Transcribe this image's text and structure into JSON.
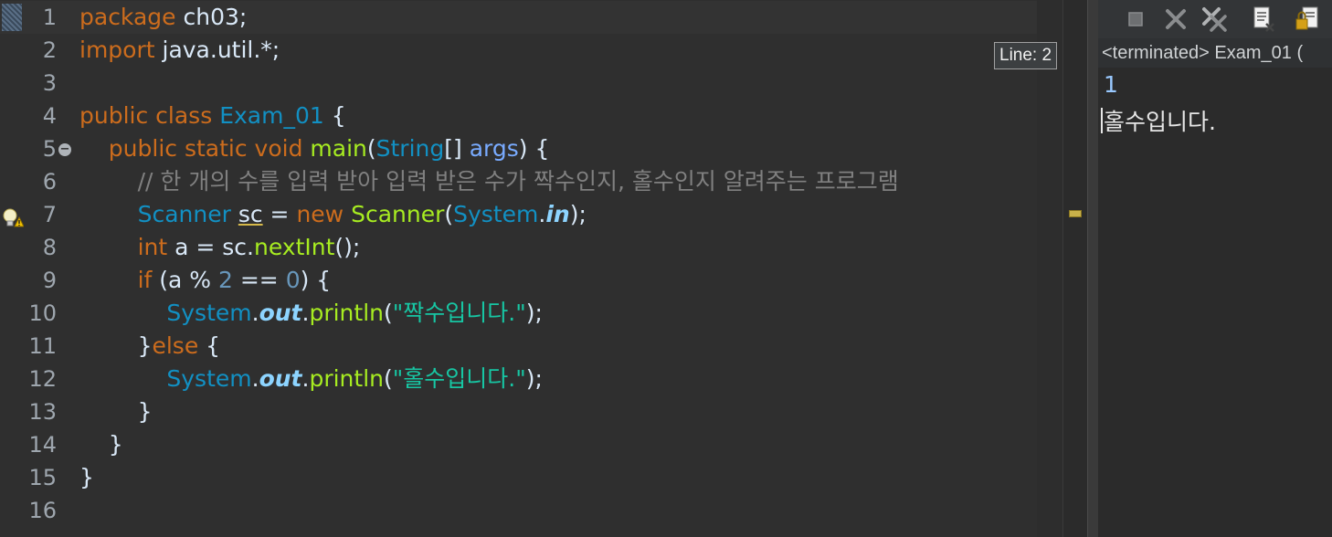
{
  "editor": {
    "lines": [
      {
        "n": "1",
        "tokens": [
          [
            "kw",
            "package"
          ],
          [
            "plain",
            " ch03;"
          ]
        ]
      },
      {
        "n": "2",
        "tokens": [
          [
            "kw",
            "import"
          ],
          [
            "plain",
            " java.util.*;"
          ]
        ]
      },
      {
        "n": "3",
        "tokens": []
      },
      {
        "n": "4",
        "tokens": [
          [
            "kw",
            "public class "
          ],
          [
            "type",
            "Exam_01"
          ],
          [
            "plain",
            " {"
          ]
        ]
      },
      {
        "n": "5",
        "tokens": [
          [
            "plain",
            "    "
          ],
          [
            "kw",
            "public static void "
          ],
          [
            "method",
            "main"
          ],
          [
            "plain",
            "("
          ],
          [
            "type",
            "String"
          ],
          [
            "plain",
            "[] "
          ],
          [
            "param",
            "args"
          ],
          [
            "plain",
            ") {"
          ]
        ]
      },
      {
        "n": "6",
        "tokens": [
          [
            "plain",
            "        "
          ],
          [
            "comment",
            "// 한 개의 수를 입력 받아 입력 받은 수가 짝수인지, 홀수인지 알려주는 프로그램"
          ]
        ]
      },
      {
        "n": "7",
        "tokens": [
          [
            "plain",
            "        "
          ],
          [
            "type",
            "Scanner"
          ],
          [
            "plain",
            " "
          ],
          [
            "warnvar",
            "sc"
          ],
          [
            "plain",
            " = "
          ],
          [
            "kw",
            "new "
          ],
          [
            "method",
            "Scanner"
          ],
          [
            "plain",
            "("
          ],
          [
            "type",
            "System"
          ],
          [
            "plain",
            "."
          ],
          [
            "static",
            "in"
          ],
          [
            "plain",
            ");"
          ]
        ]
      },
      {
        "n": "8",
        "tokens": [
          [
            "plain",
            "        "
          ],
          [
            "kw",
            "int"
          ],
          [
            "plain",
            " a = sc."
          ],
          [
            "method",
            "nextInt"
          ],
          [
            "plain",
            "();"
          ]
        ]
      },
      {
        "n": "9",
        "tokens": [
          [
            "plain",
            "        "
          ],
          [
            "kw",
            "if"
          ],
          [
            "plain",
            " (a % "
          ],
          [
            "num",
            "2"
          ],
          [
            "plain",
            " == "
          ],
          [
            "num",
            "0"
          ],
          [
            "plain",
            ") {"
          ]
        ]
      },
      {
        "n": "10",
        "tokens": [
          [
            "plain",
            "            "
          ],
          [
            "type",
            "System"
          ],
          [
            "plain",
            "."
          ],
          [
            "static",
            "out"
          ],
          [
            "plain",
            "."
          ],
          [
            "method",
            "println"
          ],
          [
            "plain",
            "("
          ],
          [
            "str",
            "\"짝수입니다.\""
          ],
          [
            "plain",
            ");"
          ]
        ]
      },
      {
        "n": "11",
        "tokens": [
          [
            "plain",
            "        }"
          ],
          [
            "kw",
            "else"
          ],
          [
            "plain",
            " {"
          ]
        ]
      },
      {
        "n": "12",
        "tokens": [
          [
            "plain",
            "            "
          ],
          [
            "type",
            "System"
          ],
          [
            "plain",
            "."
          ],
          [
            "static",
            "out"
          ],
          [
            "plain",
            "."
          ],
          [
            "method",
            "println"
          ],
          [
            "plain",
            "("
          ],
          [
            "str",
            "\"홀수입니다.\""
          ],
          [
            "plain",
            ");"
          ]
        ]
      },
      {
        "n": "13",
        "tokens": [
          [
            "plain",
            "        }"
          ]
        ]
      },
      {
        "n": "14",
        "tokens": [
          [
            "plain",
            "    }"
          ]
        ]
      },
      {
        "n": "15",
        "tokens": [
          [
            "plain",
            "}"
          ]
        ]
      },
      {
        "n": "16",
        "tokens": []
      }
    ],
    "tooltip": "Line: 2"
  },
  "console": {
    "header": "<terminated> Exam_01 (",
    "input_line": "1",
    "output_line": "홀수입니다."
  },
  "toolbar": {
    "icons": [
      "terminate-icon",
      "remove-launch-icon",
      "remove-all-terminated-icon",
      "clear-console-icon",
      "scroll-lock-icon"
    ]
  },
  "colors": {
    "keyword": "#cc6c1d",
    "type": "#1290c3",
    "method": "#a7ec21",
    "string": "#17c6a3",
    "comment": "#808080",
    "static_field": "#8dd4ff",
    "number": "#6897bb",
    "parameter": "#79abff"
  }
}
